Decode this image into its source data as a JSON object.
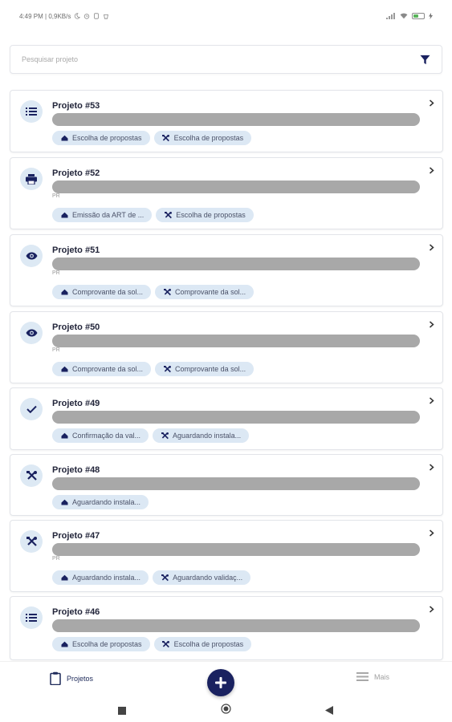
{
  "status_bar": {
    "time_info": "4:49 PM | 0,9KB/s",
    "battery_label": "",
    "colors": {
      "text": "#6b6b6b"
    }
  },
  "search": {
    "placeholder": "Pesquisar projeto",
    "filter_icon": "filter-icon"
  },
  "projects": [
    {
      "title": "Projeto #53",
      "icon": "list-icon",
      "sub": "",
      "chips": [
        {
          "icon": "house-icon",
          "label": "Escolha de propostas"
        },
        {
          "icon": "tools-icon",
          "label": "Escolha de propostas"
        }
      ]
    },
    {
      "title": "Projeto #52",
      "icon": "printer-icon",
      "sub": "PR",
      "chips": [
        {
          "icon": "house-icon",
          "label": "Emissão da ART de ..."
        },
        {
          "icon": "tools-icon",
          "label": "Escolha de propostas"
        }
      ]
    },
    {
      "title": "Projeto #51",
      "icon": "eye-icon",
      "sub": "PR",
      "chips": [
        {
          "icon": "house-icon",
          "label": "Comprovante da sol..."
        },
        {
          "icon": "tools-icon",
          "label": "Comprovante da sol..."
        }
      ]
    },
    {
      "title": "Projeto #50",
      "icon": "eye-icon",
      "sub": "PR",
      "chips": [
        {
          "icon": "house-icon",
          "label": "Comprovante da sol..."
        },
        {
          "icon": "tools-icon",
          "label": "Comprovante da sol..."
        }
      ]
    },
    {
      "title": "Projeto #49",
      "icon": "check-icon",
      "sub": "",
      "chips": [
        {
          "icon": "house-icon",
          "label": "Confirmação da val..."
        },
        {
          "icon": "tools-icon",
          "label": "Aguardando instala..."
        }
      ]
    },
    {
      "title": "Projeto #48",
      "icon": "tools-icon",
      "sub": "",
      "chips": [
        {
          "icon": "house-icon",
          "label": "Aguardando instala..."
        }
      ]
    },
    {
      "title": "Projeto #47",
      "icon": "tools-icon",
      "sub": "PR",
      "chips": [
        {
          "icon": "house-icon",
          "label": "Aguardando instala..."
        },
        {
          "icon": "tools-icon",
          "label": "Aguardando validaç..."
        }
      ]
    },
    {
      "title": "Projeto #46",
      "icon": "list-icon",
      "sub": "",
      "chips": [
        {
          "icon": "house-icon",
          "label": "Escolha de propostas"
        },
        {
          "icon": "tools-icon",
          "label": "Escolha de propostas"
        }
      ]
    }
  ],
  "bottom_nav": {
    "projects_label": "Projetos",
    "more_label": "Mais",
    "add_icon": "plus-icon"
  },
  "colors": {
    "accent": "#1a2260",
    "chip_bg": "#dce8f4",
    "icon_circle_bg": "#dde9f4",
    "placeholder_bar": "#a8a8a8"
  }
}
